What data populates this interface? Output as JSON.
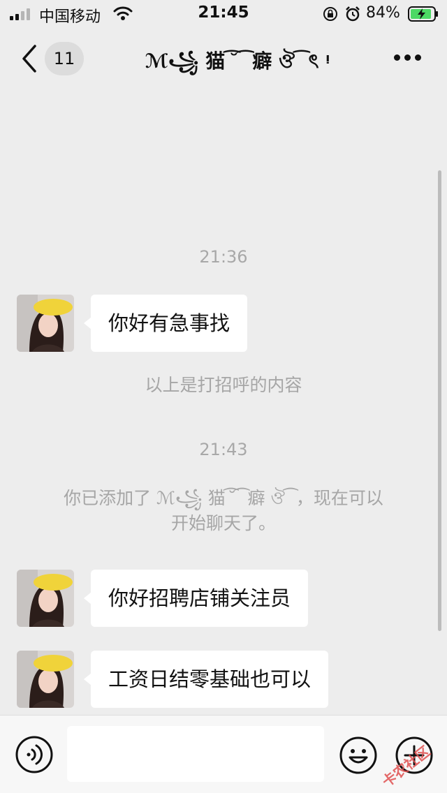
{
  "status_bar": {
    "carrier": "中国移动",
    "time": "21:45",
    "battery": "84%",
    "icons": [
      "signal-icon",
      "wifi-icon",
      "rotation-lock-icon",
      "alarm-icon",
      "battery-charging-icon"
    ]
  },
  "nav": {
    "back_icon": "chevron-left-icon",
    "unread_count": "11",
    "title": "ℳ꧁ 猫 ͡ ̆ ͡ 癖 ঔ ͡ ৎ ᵎ",
    "more_icon": "more-dots-icon"
  },
  "messages": [
    {
      "type": "time",
      "text": "21:36"
    },
    {
      "type": "incoming",
      "text": "你好有急事找"
    },
    {
      "type": "system",
      "text": "以上是打招呼的内容"
    },
    {
      "type": "time",
      "text": "21:43"
    },
    {
      "type": "system",
      "line1": "你已添加了 ℳ꧁ 猫 ͡ ̆ ͡ 癖 ঔ ͡ ，现在可以",
      "line2": "开始聊天了。"
    },
    {
      "type": "incoming",
      "text": "你好招聘店铺关注员"
    },
    {
      "type": "incoming",
      "text": "工资日结零基础也可以"
    }
  ],
  "input_bar": {
    "voice_icon": "voice-icon",
    "input_value": "",
    "emoji_icon": "emoji-icon",
    "more_icon": "plus-circle-icon"
  },
  "watermark": "卡农社区",
  "colors": {
    "background": "#ededed",
    "bubble": "#ffffff",
    "muted_text": "#a8a8a8",
    "battery_green": "#4cd964"
  }
}
